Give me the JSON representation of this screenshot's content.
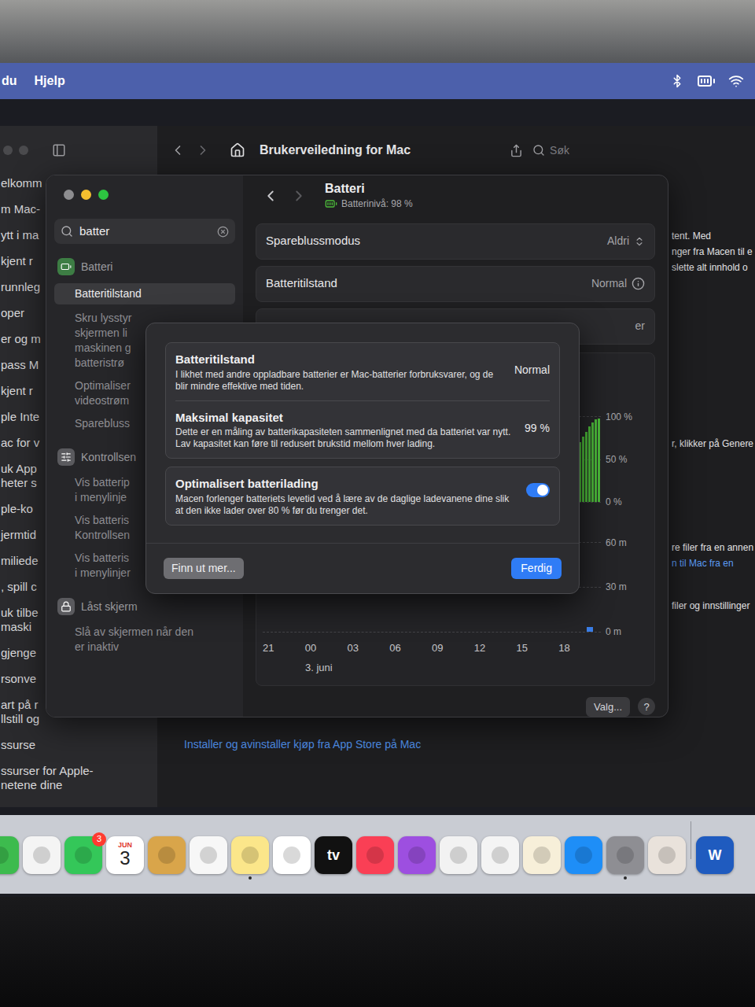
{
  "menu_bar": {
    "items": [
      "du",
      "Hjelp"
    ]
  },
  "help_window": {
    "title": "Brukerveiledning for Mac",
    "search_placeholder": "Søk",
    "sidebar_items": [
      [
        "elkomm"
      ],
      [
        "m Mac-"
      ],
      [
        "ytt i ma"
      ],
      [
        "kjent r"
      ],
      [
        "runnleg"
      ],
      [
        "oper"
      ],
      [
        "er og m"
      ],
      [
        "pass M"
      ],
      [
        "kjent r"
      ],
      [
        "ple Inte"
      ],
      [
        "ac for v"
      ],
      [
        "uk App",
        "heter s"
      ],
      [
        "ple-ko"
      ],
      [
        "jermtid"
      ],
      [
        "miliede"
      ],
      [
        ", spill c"
      ],
      [
        "uk tilbe",
        "maski"
      ],
      [
        "gjenge"
      ],
      [
        "rsonve"
      ],
      [
        "art på r",
        "llstill og"
      ],
      [
        "ssurse"
      ],
      [
        "ssurser for Apple-",
        "netene dine"
      ]
    ],
    "content_paragraphs": [
      [
        {
          "text": "tent. Med",
          "link": false
        },
        {
          "text": "nger fra Macen til e",
          "link": false
        },
        {
          "text": "slette alt innhold o",
          "link": false
        }
      ],
      [
        {
          "text": "r, klikker på Genere",
          "link": false
        }
      ],
      [
        {
          "text": "re filer fra en annen",
          "link": false
        },
        {
          "text": "n til Mac fra en",
          "link": true
        }
      ],
      [
        {
          "text": "filer og innstillinger",
          "link": false
        }
      ]
    ],
    "footer_link": "Installer og avinstaller kjøp fra App Store på Mac"
  },
  "settings_window": {
    "search": {
      "value": "batter"
    },
    "results": [
      {
        "kind": "header",
        "lines": [
          "Batteri"
        ],
        "selected": false
      },
      {
        "kind": "item",
        "lines": [
          "Batteritilstand"
        ],
        "selected": true
      },
      {
        "kind": "item",
        "lines": [
          "Skru lysstyr",
          "skjermen li",
          "maskinen g",
          "batteristrø"
        ],
        "selected": false
      },
      {
        "kind": "item",
        "lines": [
          "Optimaliser",
          "videostrøm"
        ],
        "selected": false
      },
      {
        "kind": "item",
        "lines": [
          "Sparebluss"
        ],
        "selected": false
      },
      {
        "kind": "header",
        "lines": [
          "Kontrollsen"
        ],
        "selected": false
      },
      {
        "kind": "item",
        "lines": [
          "Vis batterip",
          "i menylinje"
        ],
        "selected": false
      },
      {
        "kind": "item",
        "lines": [
          "Vis batteris",
          "Kontrollsen"
        ],
        "selected": false
      },
      {
        "kind": "item",
        "lines": [
          "Vis batteris",
          "i menylinjer"
        ],
        "selected": false
      },
      {
        "kind": "header",
        "lines": [
          "Låst skjerm"
        ],
        "selected": false
      },
      {
        "kind": "item",
        "lines": [
          "Slå av skjermen når den",
          "er inaktiv"
        ],
        "selected": false
      }
    ],
    "title": "Batteri",
    "subtitle": "Batterinivå: 98 %",
    "rows": [
      {
        "kind": "popup",
        "label": "Spareblussmodus",
        "value": "Aldri"
      },
      {
        "kind": "info",
        "label": "Batteritilstand",
        "value": "Normal"
      },
      {
        "kind": "partial",
        "label": "",
        "value": "er"
      }
    ],
    "chart": {
      "level_ticks": [
        "100 %",
        "50 %",
        "0 %"
      ],
      "usage_ticks": [
        "60 m",
        "30 m",
        "0 m"
      ],
      "hours": [
        "21",
        "00",
        "03",
        "06",
        "09",
        "12",
        "15",
        "18"
      ],
      "date": "3. juni",
      "battery_level": [
        42,
        50,
        57,
        64,
        70,
        76,
        82,
        88,
        93,
        97,
        98
      ],
      "screen_usage_minutes": [
        3
      ]
    },
    "buttons": [
      "Valg...",
      "?"
    ]
  },
  "dialog": {
    "rows": [
      {
        "title": "Batteritilstand",
        "description": "I likhet med andre oppladbare batterier er Mac-batterier forbruksvarer, og de blir mindre effektive med tiden.",
        "value": "Normal"
      },
      {
        "title": "Maksimal kapasitet",
        "description": "Dette er en måling av batterikapasiteten sammenlignet med da batteriet var nytt. Lav kapasitet kan føre til redusert brukstid mellom hver lading.",
        "value": "99 %"
      }
    ],
    "toggle": {
      "title": "Optimalisert batterilading",
      "description": "Macen forlenger batteriets levetid ved å lære av de daglige ladevanene dine slik at den ikke lader over 80 % før du trenger det.",
      "on": true
    },
    "buttons": [
      {
        "label": "Finn ut mer...",
        "primary": false
      },
      {
        "label": "Ferdig",
        "primary": true
      }
    ]
  },
  "dock": {
    "apps": [
      {
        "kind": "plain",
        "color": "#3dbb4e",
        "running": false
      },
      {
        "kind": "plain",
        "color": "#f4f4f4",
        "running": false
      },
      {
        "kind": "plain",
        "color": "#34c759",
        "running": false,
        "badge": "3"
      },
      {
        "kind": "calendar",
        "color": "#ffffff",
        "running": false,
        "month": "JUN",
        "day": "3"
      },
      {
        "kind": "plain",
        "color": "#d9a54a",
        "running": false
      },
      {
        "kind": "plain",
        "color": "#f7f7f7",
        "running": false
      },
      {
        "kind": "plain",
        "color": "#fbe68a",
        "running": true
      },
      {
        "kind": "plain",
        "color": "#ffffff",
        "running": false
      },
      {
        "kind": "label",
        "color": "#111111",
        "running": false,
        "label": "tv"
      },
      {
        "kind": "plain",
        "color": "#fa3f55",
        "running": false
      },
      {
        "kind": "plain",
        "color": "#9d4fe0",
        "running": false
      },
      {
        "kind": "plain",
        "color": "#f2f2f2",
        "running": false
      },
      {
        "kind": "plain",
        "color": "#f4f4f4",
        "running": false
      },
      {
        "kind": "plain",
        "color": "#f7efd9",
        "running": false
      },
      {
        "kind": "plain",
        "color": "#1e8ef7",
        "running": false
      },
      {
        "kind": "plain",
        "color": "#8e8e93",
        "running": true
      },
      {
        "kind": "plain",
        "color": "#e9e2db",
        "running": false
      }
    ],
    "documents": [
      {
        "kind": "label",
        "color": "#1f5bbf",
        "running": false,
        "label": "W"
      }
    ]
  }
}
